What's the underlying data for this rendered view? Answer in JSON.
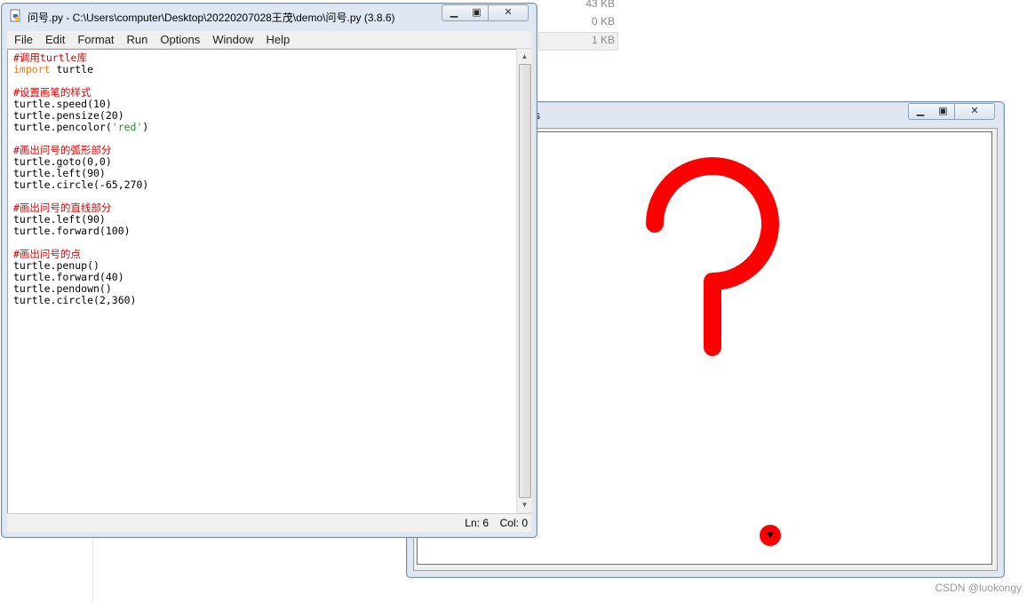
{
  "background": {
    "file_sizes": [
      "43 KB",
      "0 KB",
      "1 KB"
    ]
  },
  "idle_window": {
    "title": "问号.py - C:\\Users\\computer\\Desktop\\20220207028王茂\\demo\\问号.py (3.8.6)",
    "menu": [
      "File",
      "Edit",
      "Format",
      "Run",
      "Options",
      "Window",
      "Help"
    ],
    "status": {
      "line": "Ln: 6",
      "col": "Col: 0"
    }
  },
  "code_lines": [
    [
      {
        "t": "#调用turtle库",
        "c": "comment"
      }
    ],
    [
      {
        "t": "import",
        "c": "keyword"
      },
      {
        "t": " turtle",
        "c": "plain"
      }
    ],
    [
      {
        "t": "",
        "c": "plain"
      }
    ],
    [
      {
        "t": "#设置画笔的样式",
        "c": "comment"
      }
    ],
    [
      {
        "t": "turtle.speed(10)",
        "c": "plain"
      }
    ],
    [
      {
        "t": "turtle.pensize(20)",
        "c": "plain"
      }
    ],
    [
      {
        "t": "turtle.pencolor(",
        "c": "plain"
      },
      {
        "t": "'red'",
        "c": "string"
      },
      {
        "t": ")",
        "c": "plain"
      }
    ],
    [
      {
        "t": "",
        "c": "plain"
      }
    ],
    [
      {
        "t": "#画出问号的弧形部分",
        "c": "comment"
      }
    ],
    [
      {
        "t": "turtle.goto(0,0)",
        "c": "plain"
      }
    ],
    [
      {
        "t": "turtle.left(90)",
        "c": "plain"
      }
    ],
    [
      {
        "t": "turtle.circle(-65,270)",
        "c": "plain"
      }
    ],
    [
      {
        "t": "",
        "c": "plain"
      }
    ],
    [
      {
        "t": "#画出问号的直线部分",
        "c": "comment"
      }
    ],
    [
      {
        "t": "turtle.left(90)",
        "c": "plain"
      }
    ],
    [
      {
        "t": "turtle.forward(100)",
        "c": "plain"
      }
    ],
    [
      {
        "t": "",
        "c": "plain"
      }
    ],
    [
      {
        "t": "#画出问号的点",
        "c": "comment"
      }
    ],
    [
      {
        "t": "turtle.penup()",
        "c": "plain"
      }
    ],
    [
      {
        "t": "turtle.forward(40)",
        "c": "plain"
      }
    ],
    [
      {
        "t": "turtle.pendown()",
        "c": "plain"
      }
    ],
    [
      {
        "t": "turtle.circle(2,360)",
        "c": "plain"
      }
    ]
  ],
  "turtle_window": {
    "title_fragment": "cs",
    "pen_color": "#ff0000"
  },
  "watermark": "CSDN @luokongy",
  "colors": {
    "comment": "#dd0000",
    "keyword": "#ff7700",
    "string": "#00aa00",
    "pen": "#ff0000"
  }
}
